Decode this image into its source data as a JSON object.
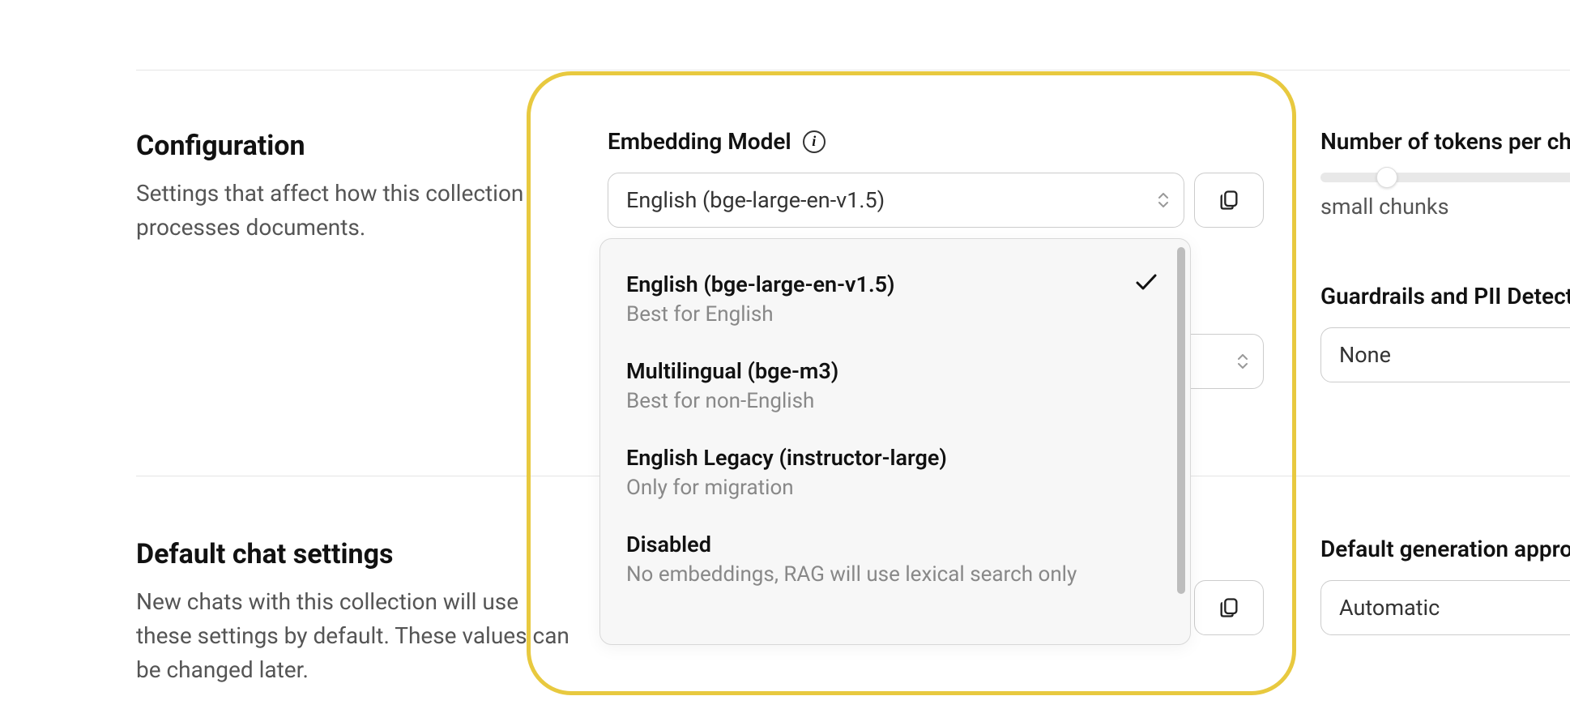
{
  "configuration": {
    "title": "Configuration",
    "description": "Settings that affect how this collection processes documents."
  },
  "chat_settings": {
    "title": "Default chat settings",
    "description": "New chats with this collection will use these settings by default. These values can be changed later."
  },
  "embedding": {
    "label": "Embedding Model",
    "selected": "English (bge-large-en-v1.5)",
    "options": [
      {
        "title": "English (bge-large-en-v1.5)",
        "sub": "Best for English",
        "selected": true
      },
      {
        "title": "Multilingual (bge-m3)",
        "sub": "Best for non-English",
        "selected": false
      },
      {
        "title": "English Legacy (instructor-large)",
        "sub": "Only for migration",
        "selected": false
      },
      {
        "title": "Disabled",
        "sub": "No embeddings, RAG will use lexical search only",
        "selected": false
      }
    ]
  },
  "tokens": {
    "label": "Number of tokens per ch",
    "value_label": "small chunks"
  },
  "guardrails": {
    "label": "Guardrails and PII Detect",
    "selected": "None"
  },
  "generation": {
    "label": "Default generation appro",
    "selected": "Automatic"
  }
}
